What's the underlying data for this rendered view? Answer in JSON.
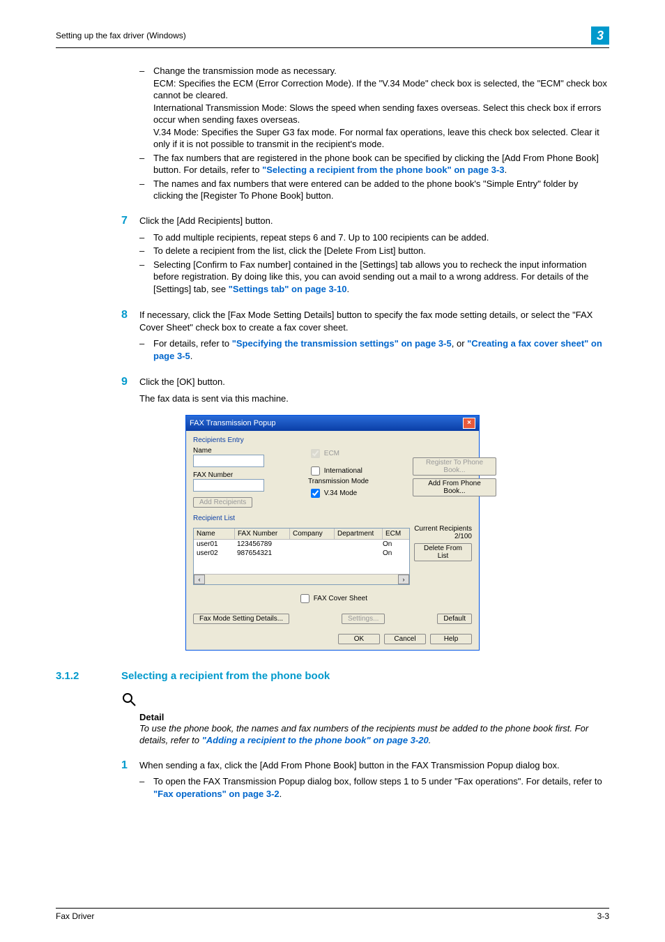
{
  "header": {
    "breadcrumb": "Setting up the fax driver (Windows)",
    "chapter_num": "3"
  },
  "block1": {
    "items": [
      {
        "lead": "Change the transmission mode as necessary.",
        "lines": [
          "ECM: Specifies the ECM (Error Correction Mode). If the \"V.34 Mode\" check box is selected, the \"ECM\" check box cannot be cleared.",
          "International Transmission Mode: Slows the speed when sending faxes overseas. Select this check box if errors occur when sending faxes overseas.",
          "V.34 Mode: Specifies the Super G3 fax mode. For normal fax operations, leave this check box selected. Clear it only if it is not possible to transmit in the recipient's mode."
        ]
      },
      {
        "lead": "The fax numbers that are registered in the phone book can be specified by clicking the [Add From Phone Book] button. For details, refer to ",
        "link": "\"Selecting a recipient from the phone book\" on page 3-3",
        "tail": "."
      },
      {
        "lead": "The names and fax numbers that were entered can be added to the phone book's \"Simple Entry\" folder by clicking the [Register To Phone Book] button."
      }
    ]
  },
  "steps": {
    "s7": {
      "num": "7",
      "text": "Click the [Add Recipients] button.",
      "items": [
        {
          "text": "To add multiple recipients, repeat steps 6 and 7. Up to 100 recipients can be added."
        },
        {
          "text": "To delete a recipient from the list, click the [Delete From List] button."
        },
        {
          "text_a": "Selecting [Confirm to Fax number] contained in the [Settings] tab allows you to recheck the input information before registration. By doing like this, you can avoid sending out a mail to a wrong address. For details of the [Settings] tab, see ",
          "link": "\"Settings tab\" on page 3-10",
          "text_b": "."
        }
      ]
    },
    "s8": {
      "num": "8",
      "text": "If necessary, click the [Fax Mode Setting Details] button to specify the fax mode setting details, or select the \"FAX Cover Sheet\" check box to create a fax cover sheet.",
      "items": [
        {
          "text_a": "For details, refer to ",
          "link1": "\"Specifying the transmission settings\" on page 3-5",
          "mid": ", or ",
          "link2": "\"Creating a fax cover sheet\" on page 3-5",
          "text_b": "."
        }
      ]
    },
    "s9": {
      "num": "9",
      "text": "Click the [OK] button.",
      "after": "The fax data is sent via this machine."
    }
  },
  "dialog": {
    "title": "FAX Transmission Popup",
    "group1": "Recipients Entry",
    "name_label": "Name",
    "fax_label": "FAX Number",
    "ecm_cb": "ECM",
    "intl_cb": "International Transmission Mode",
    "v34_cb": "V.34 Mode",
    "add_recipients_btn": "Add Recipients",
    "register_btn": "Register To Phone Book...",
    "add_from_btn": "Add From Phone Book...",
    "group2": "Recipient List",
    "cols": {
      "name": "Name",
      "fax": "FAX Number",
      "company": "Company",
      "dept": "Department",
      "ecm": "ECM"
    },
    "rows": [
      {
        "name": "user01",
        "fax": "123456789",
        "ecm": "On"
      },
      {
        "name": "user02",
        "fax": "987654321",
        "ecm": "On"
      }
    ],
    "current_recipients": "Current Recipients 2/100",
    "delete_btn": "Delete From List",
    "cover_sheet_cb": "FAX Cover Sheet",
    "mode_details_btn": "Fax Mode Setting Details...",
    "settings_btn": "Settings...",
    "default_btn": "Default",
    "ok_btn": "OK",
    "cancel_btn": "Cancel",
    "help_btn": "Help"
  },
  "section": {
    "num": "3.1.2",
    "title": "Selecting a recipient from the phone book"
  },
  "detail": {
    "label": "Detail",
    "text_a": "To use the phone book, the names and fax numbers of the recipients must be added to the phone book first. For details, refer to ",
    "link": "\"Adding a recipient to the phone book\" on page 3-20",
    "text_b": "."
  },
  "step1": {
    "num": "1",
    "text": "When sending a fax, click the [Add From Phone Book] button in the FAX Transmission Popup dialog box.",
    "items": [
      {
        "text_a": "To open the FAX Transmission Popup dialog box, follow steps 1 to 5 under \"Fax operations\". For details, refer to ",
        "link": "\"Fax operations\" on page 3-2",
        "text_b": "."
      }
    ]
  },
  "footer": {
    "left": "Fax Driver",
    "right": "3-3"
  }
}
